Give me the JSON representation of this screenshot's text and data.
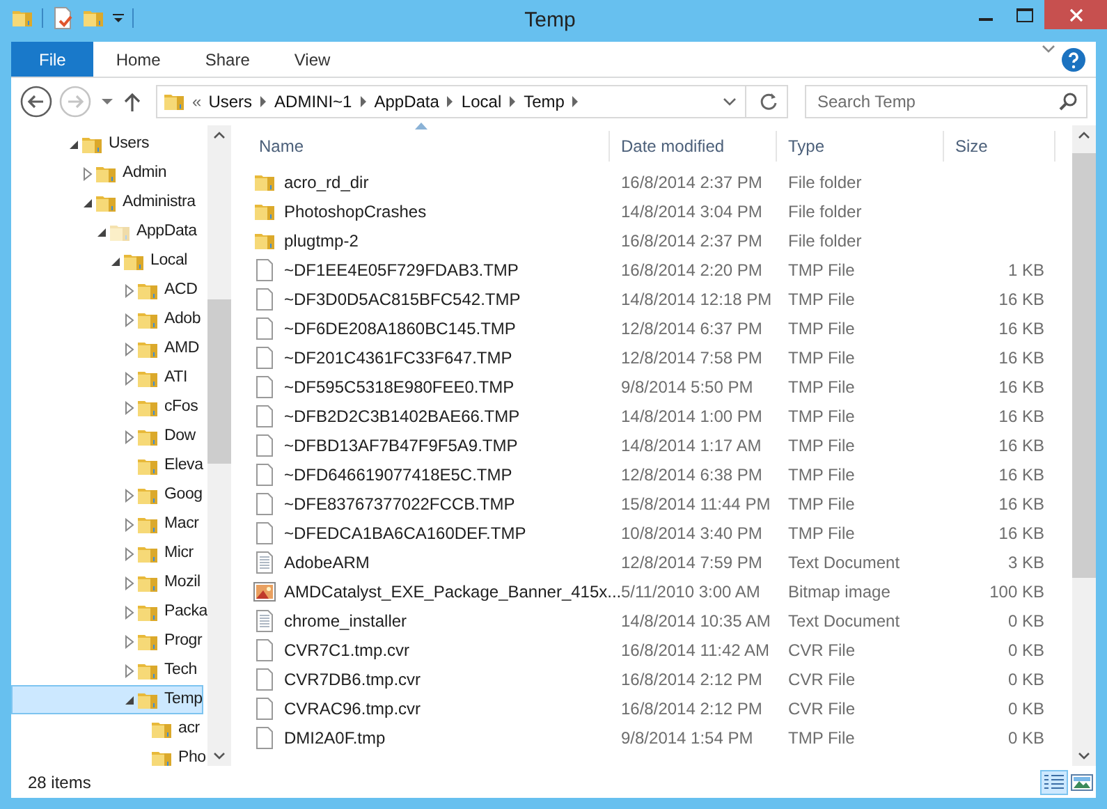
{
  "window": {
    "title": "Temp"
  },
  "ribbon": {
    "tabs": [
      {
        "label": "File",
        "kind": "file",
        "selected": false
      },
      {
        "label": "Home",
        "kind": "tab",
        "selected": false
      },
      {
        "label": "Share",
        "kind": "tab",
        "selected": false
      },
      {
        "label": "View",
        "kind": "tab",
        "selected": false
      }
    ]
  },
  "navigation": {
    "back_disabled": false,
    "forward_disabled": true
  },
  "address_bar": {
    "overflow": "«",
    "crumbs": [
      "Users",
      "ADMINI~1",
      "AppData",
      "Local",
      "Temp"
    ]
  },
  "search": {
    "placeholder": "Search Temp"
  },
  "sidebar": {
    "items": [
      {
        "label": "Users",
        "expanded": true,
        "hidden": false,
        "selected": false,
        "children": [
          {
            "label": "Admin",
            "expanded": false,
            "hidden": false,
            "selected": false
          },
          {
            "label": "Administra",
            "expanded": true,
            "hidden": false,
            "selected": false,
            "children": [
              {
                "label": "AppData",
                "expanded": true,
                "hidden": true,
                "selected": false,
                "children": [
                  {
                    "label": "Local",
                    "expanded": true,
                    "hidden": false,
                    "selected": false,
                    "children": [
                      {
                        "label": "ACD",
                        "expanded": false,
                        "hidden": false,
                        "selected": false
                      },
                      {
                        "label": "Adob",
                        "expanded": false,
                        "hidden": false,
                        "selected": false
                      },
                      {
                        "label": "AMD",
                        "expanded": false,
                        "hidden": false,
                        "selected": false
                      },
                      {
                        "label": "ATI",
                        "expanded": false,
                        "hidden": false,
                        "selected": false
                      },
                      {
                        "label": "cFos",
                        "expanded": false,
                        "hidden": false,
                        "selected": false
                      },
                      {
                        "label": "Dow",
                        "expanded": false,
                        "hidden": false,
                        "selected": false
                      },
                      {
                        "label": "Eleva",
                        "hidden": false,
                        "selected": false
                      },
                      {
                        "label": "Goog",
                        "expanded": false,
                        "hidden": false,
                        "selected": false
                      },
                      {
                        "label": "Macr",
                        "expanded": false,
                        "hidden": false,
                        "selected": false
                      },
                      {
                        "label": "Micr",
                        "expanded": false,
                        "hidden": false,
                        "selected": false
                      },
                      {
                        "label": "Mozil",
                        "expanded": false,
                        "hidden": false,
                        "selected": false
                      },
                      {
                        "label": "Packa",
                        "expanded": false,
                        "hidden": false,
                        "selected": false
                      },
                      {
                        "label": "Progr",
                        "expanded": false,
                        "hidden": false,
                        "selected": false
                      },
                      {
                        "label": "Tech",
                        "expanded": false,
                        "hidden": false,
                        "selected": false
                      },
                      {
                        "label": "Temp",
                        "expanded": true,
                        "hidden": false,
                        "selected": true,
                        "children": [
                          {
                            "label": "acr",
                            "hidden": false,
                            "selected": false
                          },
                          {
                            "label": "Pho",
                            "hidden": false,
                            "selected": false
                          }
                        ]
                      }
                    ]
                  }
                ]
              }
            ]
          }
        ]
      }
    ]
  },
  "table": {
    "columns": [
      {
        "label": "Name",
        "sorted": true
      },
      {
        "label": "Date modified",
        "sorted": false
      },
      {
        "label": "Type",
        "sorted": false
      },
      {
        "label": "Size",
        "sorted": false
      }
    ],
    "rows": [
      {
        "kind": "folder",
        "name": "acro_rd_dir",
        "date": "16/8/2014 2:37 PM",
        "type": "File folder"
      },
      {
        "kind": "folder",
        "name": "PhotoshopCrashes",
        "date": "14/8/2014 3:04 PM",
        "type": "File folder"
      },
      {
        "kind": "folder",
        "name": "plugtmp-2",
        "date": "16/8/2014 2:37 PM",
        "type": "File folder"
      },
      {
        "kind": "file",
        "name": "~DF1EE4E05F729FDAB3.TMP",
        "date": "16/8/2014 2:20 PM",
        "type": "TMP File",
        "size": "1 KB"
      },
      {
        "kind": "file",
        "name": "~DF3D0D5AC815BFC542.TMP",
        "date": "14/8/2014 12:18 PM",
        "type": "TMP File",
        "size": "16 KB"
      },
      {
        "kind": "file",
        "name": "~DF6DE208A1860BC145.TMP",
        "date": "12/8/2014 6:37 PM",
        "type": "TMP File",
        "size": "16 KB"
      },
      {
        "kind": "file",
        "name": "~DF201C4361FC33F647.TMP",
        "date": "12/8/2014 7:58 PM",
        "type": "TMP File",
        "size": "16 KB"
      },
      {
        "kind": "file",
        "name": "~DF595C5318E980FEE0.TMP",
        "date": "9/8/2014 5:50 PM",
        "type": "TMP File",
        "size": "16 KB"
      },
      {
        "kind": "file",
        "name": "~DFB2D2C3B1402BAE66.TMP",
        "date": "14/8/2014 1:00 PM",
        "type": "TMP File",
        "size": "16 KB"
      },
      {
        "kind": "file",
        "name": "~DFBD13AF7B47F9F5A9.TMP",
        "date": "14/8/2014 1:17 AM",
        "type": "TMP File",
        "size": "16 KB"
      },
      {
        "kind": "file",
        "name": "~DFD646619077418E5C.TMP",
        "date": "12/8/2014 6:38 PM",
        "type": "TMP File",
        "size": "16 KB"
      },
      {
        "kind": "file",
        "name": "~DFE83767377022FCCB.TMP",
        "date": "15/8/2014 11:44 PM",
        "type": "TMP File",
        "size": "16 KB"
      },
      {
        "kind": "file",
        "name": "~DFEDCA1BA6CA160DEF.TMP",
        "date": "10/8/2014 3:40 PM",
        "type": "TMP File",
        "size": "16 KB"
      },
      {
        "kind": "text",
        "name": "AdobeARM",
        "date": "12/8/2014 7:59 PM",
        "type": "Text Document",
        "size": "3 KB"
      },
      {
        "kind": "bitmap",
        "name": "AMDCatalyst_EXE_Package_Banner_415x...",
        "date": "5/11/2010 3:00 AM",
        "type": "Bitmap image",
        "size": "100 KB"
      },
      {
        "kind": "text",
        "name": "chrome_installer",
        "date": "14/8/2014 10:35 AM",
        "type": "Text Document",
        "size": "0 KB"
      },
      {
        "kind": "file",
        "name": "CVR7C1.tmp.cvr",
        "date": "16/8/2014 11:42 AM",
        "type": "CVR File",
        "size": "0 KB"
      },
      {
        "kind": "file",
        "name": "CVR7DB6.tmp.cvr",
        "date": "16/8/2014 2:12 PM",
        "type": "CVR File",
        "size": "0 KB"
      },
      {
        "kind": "file",
        "name": "CVRAC96.tmp.cvr",
        "date": "16/8/2014 2:12 PM",
        "type": "CVR File",
        "size": "0 KB"
      },
      {
        "kind": "file",
        "name": "DMI2A0F.tmp",
        "date": "9/8/2014 1:54 PM",
        "type": "TMP File",
        "size": "0 KB"
      }
    ]
  },
  "status_bar": {
    "count": "28 items",
    "views": [
      {
        "kind": "details",
        "selected": true
      },
      {
        "kind": "large-icons",
        "selected": false
      }
    ]
  }
}
